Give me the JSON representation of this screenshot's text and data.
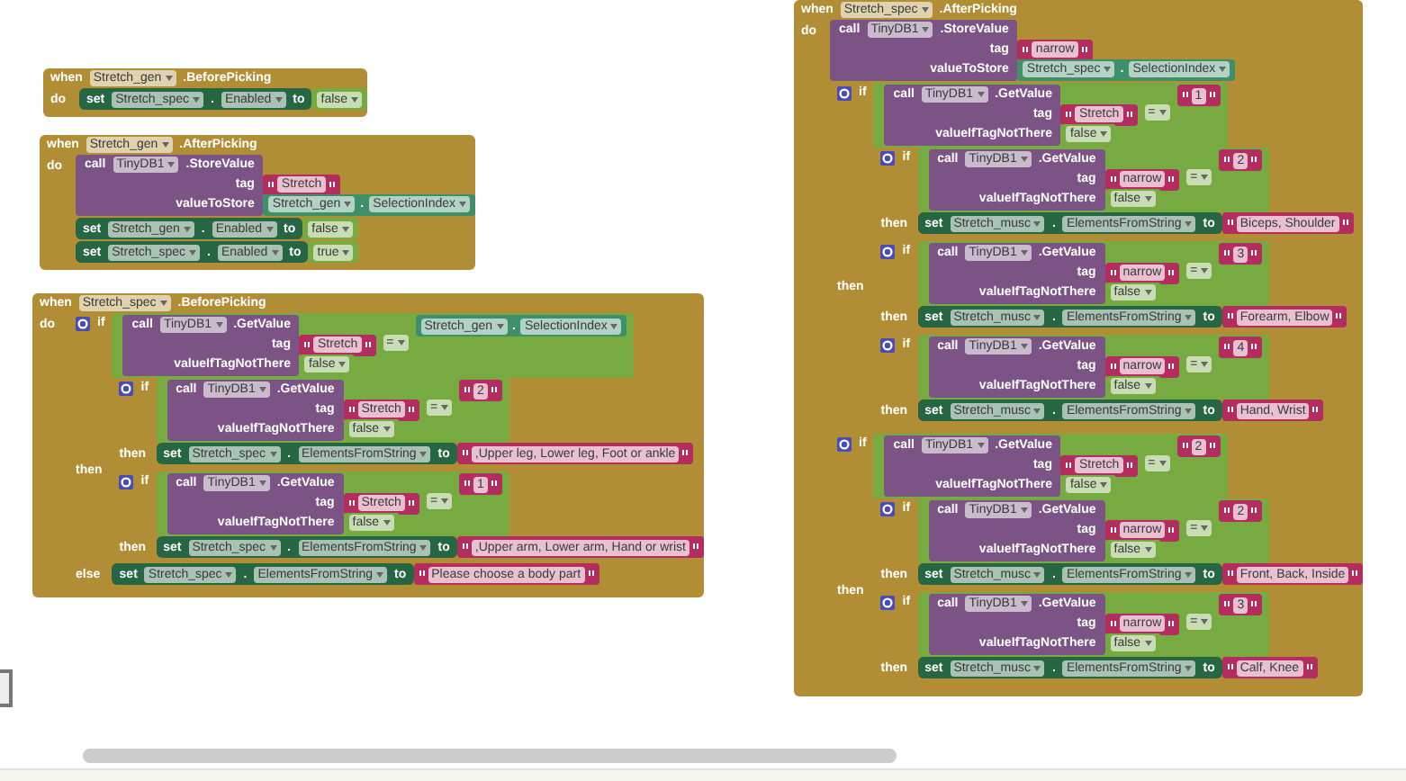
{
  "blocks": [
    {
      "when": "when",
      "component": "Stretch_gen",
      "event": ".BeforePicking",
      "do": "do",
      "body": [
        {
          "kind": "set",
          "set": "set",
          "component": "Stretch_spec",
          "dot": ".",
          "property": "Enabled",
          "to": "to",
          "value": {
            "kind": "bool",
            "text": "false"
          }
        }
      ]
    },
    {
      "when": "when",
      "component": "Stretch_gen",
      "event": ".AfterPicking",
      "do": "do",
      "body": [
        {
          "kind": "call",
          "call": "call",
          "component": "TinyDB1",
          "method": ".StoreValue",
          "args": [
            {
              "label": "tag",
              "value": {
                "kind": "text",
                "text": "Stretch"
              }
            },
            {
              "label": "valueToStore",
              "value": {
                "kind": "getter",
                "component": "Stretch_gen",
                "dot": ".",
                "property": "SelectionIndex"
              }
            }
          ]
        },
        {
          "kind": "set",
          "set": "set",
          "component": "Stretch_gen",
          "dot": ".",
          "property": "Enabled",
          "to": "to",
          "value": {
            "kind": "bool",
            "text": "false"
          }
        },
        {
          "kind": "set",
          "set": "set",
          "component": "Stretch_spec",
          "dot": ".",
          "property": "Enabled",
          "to": "to",
          "value": {
            "kind": "bool",
            "text": "true"
          }
        }
      ]
    },
    {
      "when": "when",
      "component": "Stretch_spec",
      "event": ".BeforePicking",
      "do": "do",
      "body": [
        {
          "kind": "if",
          "if": "if",
          "condition": {
            "kind": "compare",
            "op": "=",
            "left": {
              "kind": "call",
              "call": "call",
              "component": "TinyDB1",
              "method": ".GetValue",
              "args": [
                {
                  "label": "tag",
                  "value": {
                    "kind": "text",
                    "text": "Stretch"
                  }
                },
                {
                  "label": "valueIfTagNotThere",
                  "value": {
                    "kind": "bool",
                    "text": "false"
                  }
                }
              ]
            },
            "right": {
              "kind": "getter",
              "component": "Stretch_gen",
              "dot": ".",
              "property": "SelectionIndex"
            }
          },
          "then": "then",
          "then_body": [
            {
              "kind": "if",
              "if": "if",
              "condition": {
                "kind": "compare",
                "op": "=",
                "left": {
                  "kind": "call",
                  "call": "call",
                  "component": "TinyDB1",
                  "method": ".GetValue",
                  "args": [
                    {
                      "label": "tag",
                      "value": {
                        "kind": "text",
                        "text": "Stretch"
                      }
                    },
                    {
                      "label": "valueIfTagNotThere",
                      "value": {
                        "kind": "bool",
                        "text": "false"
                      }
                    }
                  ]
                },
                "right": {
                  "kind": "text",
                  "text": "2"
                }
              },
              "then": "then",
              "then_body": [
                {
                  "kind": "set",
                  "set": "set",
                  "component": "Stretch_spec",
                  "dot": ".",
                  "property": "ElementsFromString",
                  "to": "to",
                  "value": {
                    "kind": "text",
                    "text": ",Upper leg, Lower leg, Foot or ankle"
                  }
                }
              ]
            },
            {
              "kind": "if",
              "if": "if",
              "condition": {
                "kind": "compare",
                "op": "=",
                "left": {
                  "kind": "call",
                  "call": "call",
                  "component": "TinyDB1",
                  "method": ".GetValue",
                  "args": [
                    {
                      "label": "tag",
                      "value": {
                        "kind": "text",
                        "text": "Stretch"
                      }
                    },
                    {
                      "label": "valueIfTagNotThere",
                      "value": {
                        "kind": "bool",
                        "text": "false"
                      }
                    }
                  ]
                },
                "right": {
                  "kind": "text",
                  "text": "1"
                }
              },
              "then": "then",
              "then_body": [
                {
                  "kind": "set",
                  "set": "set",
                  "component": "Stretch_spec",
                  "dot": ".",
                  "property": "ElementsFromString",
                  "to": "to",
                  "value": {
                    "kind": "text",
                    "text": ",Upper arm, Lower arm, Hand or wrist"
                  }
                }
              ]
            }
          ],
          "else": "else",
          "else_body": [
            {
              "kind": "set",
              "set": "set",
              "component": "Stretch_spec",
              "dot": ".",
              "property": "ElementsFromString",
              "to": "to",
              "value": {
                "kind": "text",
                "text": "Please choose a body part"
              }
            }
          ]
        }
      ]
    },
    {
      "when": "when",
      "component": "Stretch_spec",
      "event": ".AfterPicking",
      "do": "do",
      "body": [
        {
          "kind": "call",
          "call": "call",
          "component": "TinyDB1",
          "method": ".StoreValue",
          "args": [
            {
              "label": "tag",
              "value": {
                "kind": "text",
                "text": "narrow"
              }
            },
            {
              "label": "valueToStore",
              "value": {
                "kind": "getter",
                "component": "Stretch_spec",
                "dot": ".",
                "property": "SelectionIndex"
              }
            }
          ]
        },
        {
          "kind": "if",
          "if": "if",
          "condition": {
            "kind": "compare",
            "op": "=",
            "left": {
              "kind": "call",
              "call": "call",
              "component": "TinyDB1",
              "method": ".GetValue",
              "args": [
                {
                  "label": "tag",
                  "value": {
                    "kind": "text",
                    "text": "Stretch"
                  }
                },
                {
                  "label": "valueIfTagNotThere",
                  "value": {
                    "kind": "bool",
                    "text": "false"
                  }
                }
              ]
            },
            "right": {
              "kind": "text",
              "text": "1"
            }
          },
          "then": "then",
          "then_body": [
            {
              "kind": "if",
              "if": "if",
              "condition": {
                "kind": "compare",
                "op": "=",
                "left": {
                  "kind": "call",
                  "call": "call",
                  "component": "TinyDB1",
                  "method": ".GetValue",
                  "args": [
                    {
                      "label": "tag",
                      "value": {
                        "kind": "text",
                        "text": "narrow"
                      }
                    },
                    {
                      "label": "valueIfTagNotThere",
                      "value": {
                        "kind": "bool",
                        "text": "false"
                      }
                    }
                  ]
                },
                "right": {
                  "kind": "text",
                  "text": "2"
                }
              },
              "then": "then",
              "then_body": [
                {
                  "kind": "set",
                  "set": "set",
                  "component": "Stretch_musc",
                  "dot": ".",
                  "property": "ElementsFromString",
                  "to": "to",
                  "value": {
                    "kind": "text",
                    "text": "Biceps, Shoulder"
                  }
                }
              ]
            },
            {
              "kind": "if",
              "if": "if",
              "condition": {
                "kind": "compare",
                "op": "=",
                "left": {
                  "kind": "call",
                  "call": "call",
                  "component": "TinyDB1",
                  "method": ".GetValue",
                  "args": [
                    {
                      "label": "tag",
                      "value": {
                        "kind": "text",
                        "text": "narrow"
                      }
                    },
                    {
                      "label": "valueIfTagNotThere",
                      "value": {
                        "kind": "bool",
                        "text": "false"
                      }
                    }
                  ]
                },
                "right": {
                  "kind": "text",
                  "text": "3"
                }
              },
              "then": "then",
              "then_body": [
                {
                  "kind": "set",
                  "set": "set",
                  "component": "Stretch_musc",
                  "dot": ".",
                  "property": "ElementsFromString",
                  "to": "to",
                  "value": {
                    "kind": "text",
                    "text": "Forearm, Elbow"
                  }
                }
              ]
            },
            {
              "kind": "if",
              "if": "if",
              "condition": {
                "kind": "compare",
                "op": "=",
                "left": {
                  "kind": "call",
                  "call": "call",
                  "component": "TinyDB1",
                  "method": ".GetValue",
                  "args": [
                    {
                      "label": "tag",
                      "value": {
                        "kind": "text",
                        "text": "narrow"
                      }
                    },
                    {
                      "label": "valueIfTagNotThere",
                      "value": {
                        "kind": "bool",
                        "text": "false"
                      }
                    }
                  ]
                },
                "right": {
                  "kind": "text",
                  "text": "4"
                }
              },
              "then": "then",
              "then_body": [
                {
                  "kind": "set",
                  "set": "set",
                  "component": "Stretch_musc",
                  "dot": ".",
                  "property": "ElementsFromString",
                  "to": "to",
                  "value": {
                    "kind": "text",
                    "text": "Hand, Wrist"
                  }
                }
              ]
            }
          ]
        },
        {
          "kind": "if",
          "if": "if",
          "condition": {
            "kind": "compare",
            "op": "=",
            "left": {
              "kind": "call",
              "call": "call",
              "component": "TinyDB1",
              "method": ".GetValue",
              "args": [
                {
                  "label": "tag",
                  "value": {
                    "kind": "text",
                    "text": "Stretch"
                  }
                },
                {
                  "label": "valueIfTagNotThere",
                  "value": {
                    "kind": "bool",
                    "text": "false"
                  }
                }
              ]
            },
            "right": {
              "kind": "text",
              "text": "2"
            }
          },
          "then": "then",
          "then_body": [
            {
              "kind": "if",
              "if": "if",
              "condition": {
                "kind": "compare",
                "op": "=",
                "left": {
                  "kind": "call",
                  "call": "call",
                  "component": "TinyDB1",
                  "method": ".GetValue",
                  "args": [
                    {
                      "label": "tag",
                      "value": {
                        "kind": "text",
                        "text": "narrow"
                      }
                    },
                    {
                      "label": "valueIfTagNotThere",
                      "value": {
                        "kind": "bool",
                        "text": "false"
                      }
                    }
                  ]
                },
                "right": {
                  "kind": "text",
                  "text": "2"
                }
              },
              "then": "then",
              "then_body": [
                {
                  "kind": "set",
                  "set": "set",
                  "component": "Stretch_musc",
                  "dot": ".",
                  "property": "ElementsFromString",
                  "to": "to",
                  "value": {
                    "kind": "text",
                    "text": "Front, Back, Inside"
                  }
                }
              ]
            },
            {
              "kind": "if",
              "if": "if",
              "condition": {
                "kind": "compare",
                "op": "=",
                "left": {
                  "kind": "call",
                  "call": "call",
                  "component": "TinyDB1",
                  "method": ".GetValue",
                  "args": [
                    {
                      "label": "tag",
                      "value": {
                        "kind": "text",
                        "text": "narrow"
                      }
                    },
                    {
                      "label": "valueIfTagNotThere",
                      "value": {
                        "kind": "bool",
                        "text": "false"
                      }
                    }
                  ]
                },
                "right": {
                  "kind": "text",
                  "text": "3"
                }
              },
              "then": "then",
              "then_body": [
                {
                  "kind": "set",
                  "set": "set",
                  "component": "Stretch_musc",
                  "dot": ".",
                  "property": "ElementsFromString",
                  "to": "to",
                  "value": {
                    "kind": "text",
                    "text": "Calf, Knee"
                  }
                }
              ]
            }
          ]
        }
      ]
    }
  ]
}
